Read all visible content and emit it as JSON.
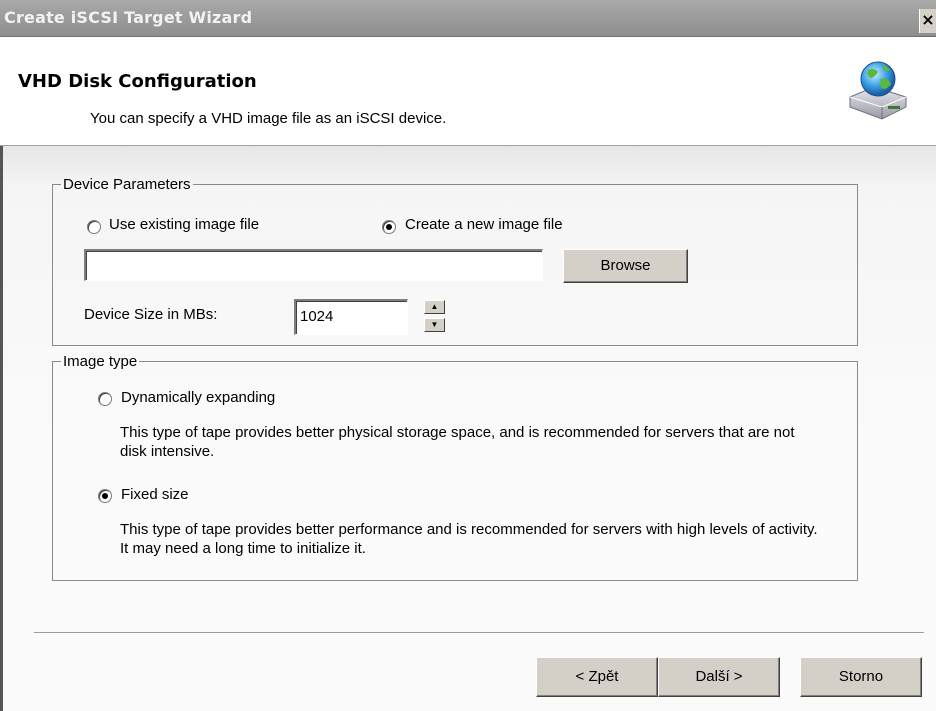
{
  "window": {
    "title": "Create iSCSI Target Wizard",
    "close_label": "×"
  },
  "header": {
    "title": "VHD Disk Configuration",
    "subtitle": "You can specify a VHD image file as an iSCSI device.",
    "icon": "globe-disk-icon"
  },
  "device_parameters": {
    "legend": "Device Parameters",
    "option_existing": "Use existing image file",
    "option_new": "Create a new image file",
    "selected": "new",
    "file_path_value": "",
    "browse_label": "Browse",
    "size_label": "Device Size in MBs:",
    "size_value": "1024"
  },
  "image_type": {
    "legend": "Image type",
    "dynamic_label": "Dynamically expanding",
    "dynamic_desc": "This type of tape provides better physical storage space, and is recommended for servers that are not disk intensive.",
    "fixed_label": "Fixed size",
    "fixed_desc": "This type of tape provides better performance and is recommended for servers with high levels of activity. It may need a long time to initialize it.",
    "selected": "fixed"
  },
  "footer": {
    "back_label": "< Zpět",
    "next_label": "Další >",
    "cancel_label": "Storno"
  }
}
